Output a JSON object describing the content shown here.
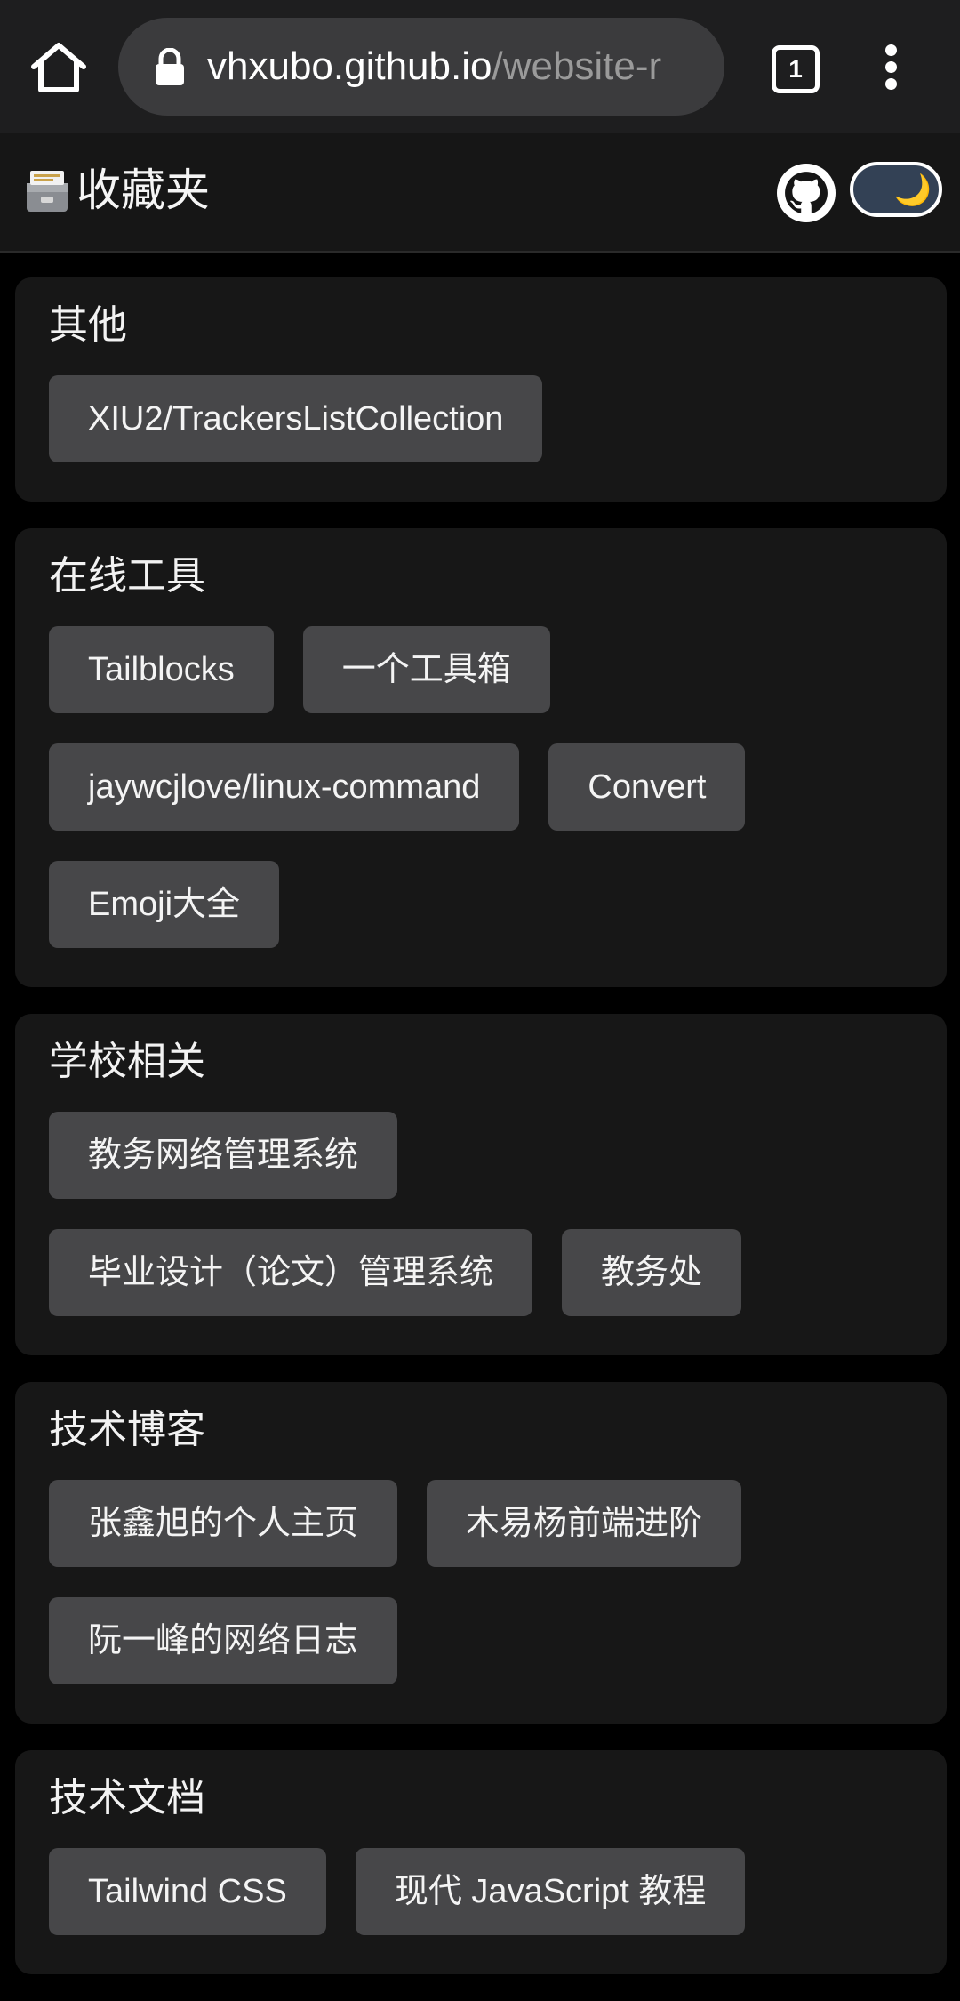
{
  "browser": {
    "url_host": "vhxubo.github.io",
    "url_path": "/website-r",
    "tab_count": "1"
  },
  "header": {
    "title": "收藏夹",
    "theme_icon": "🌙"
  },
  "sections": [
    {
      "title": "其他",
      "links": [
        "XIU2/TrackersListCollection"
      ]
    },
    {
      "title": "在线工具",
      "links": [
        "Tailblocks",
        "一个工具箱",
        "jaywcjlove/linux-command",
        "Convert",
        "Emoji大全"
      ]
    },
    {
      "title": "学校相关",
      "links": [
        "教务网络管理系统",
        "毕业设计（论文）管理系统",
        "教务处"
      ]
    },
    {
      "title": "技术博客",
      "links": [
        "张鑫旭的个人主页",
        "木易杨前端进阶",
        "阮一峰的网络日志"
      ]
    },
    {
      "title": "技术文档",
      "links": [
        "Tailwind CSS",
        "现代 JavaScript 教程"
      ]
    }
  ]
}
